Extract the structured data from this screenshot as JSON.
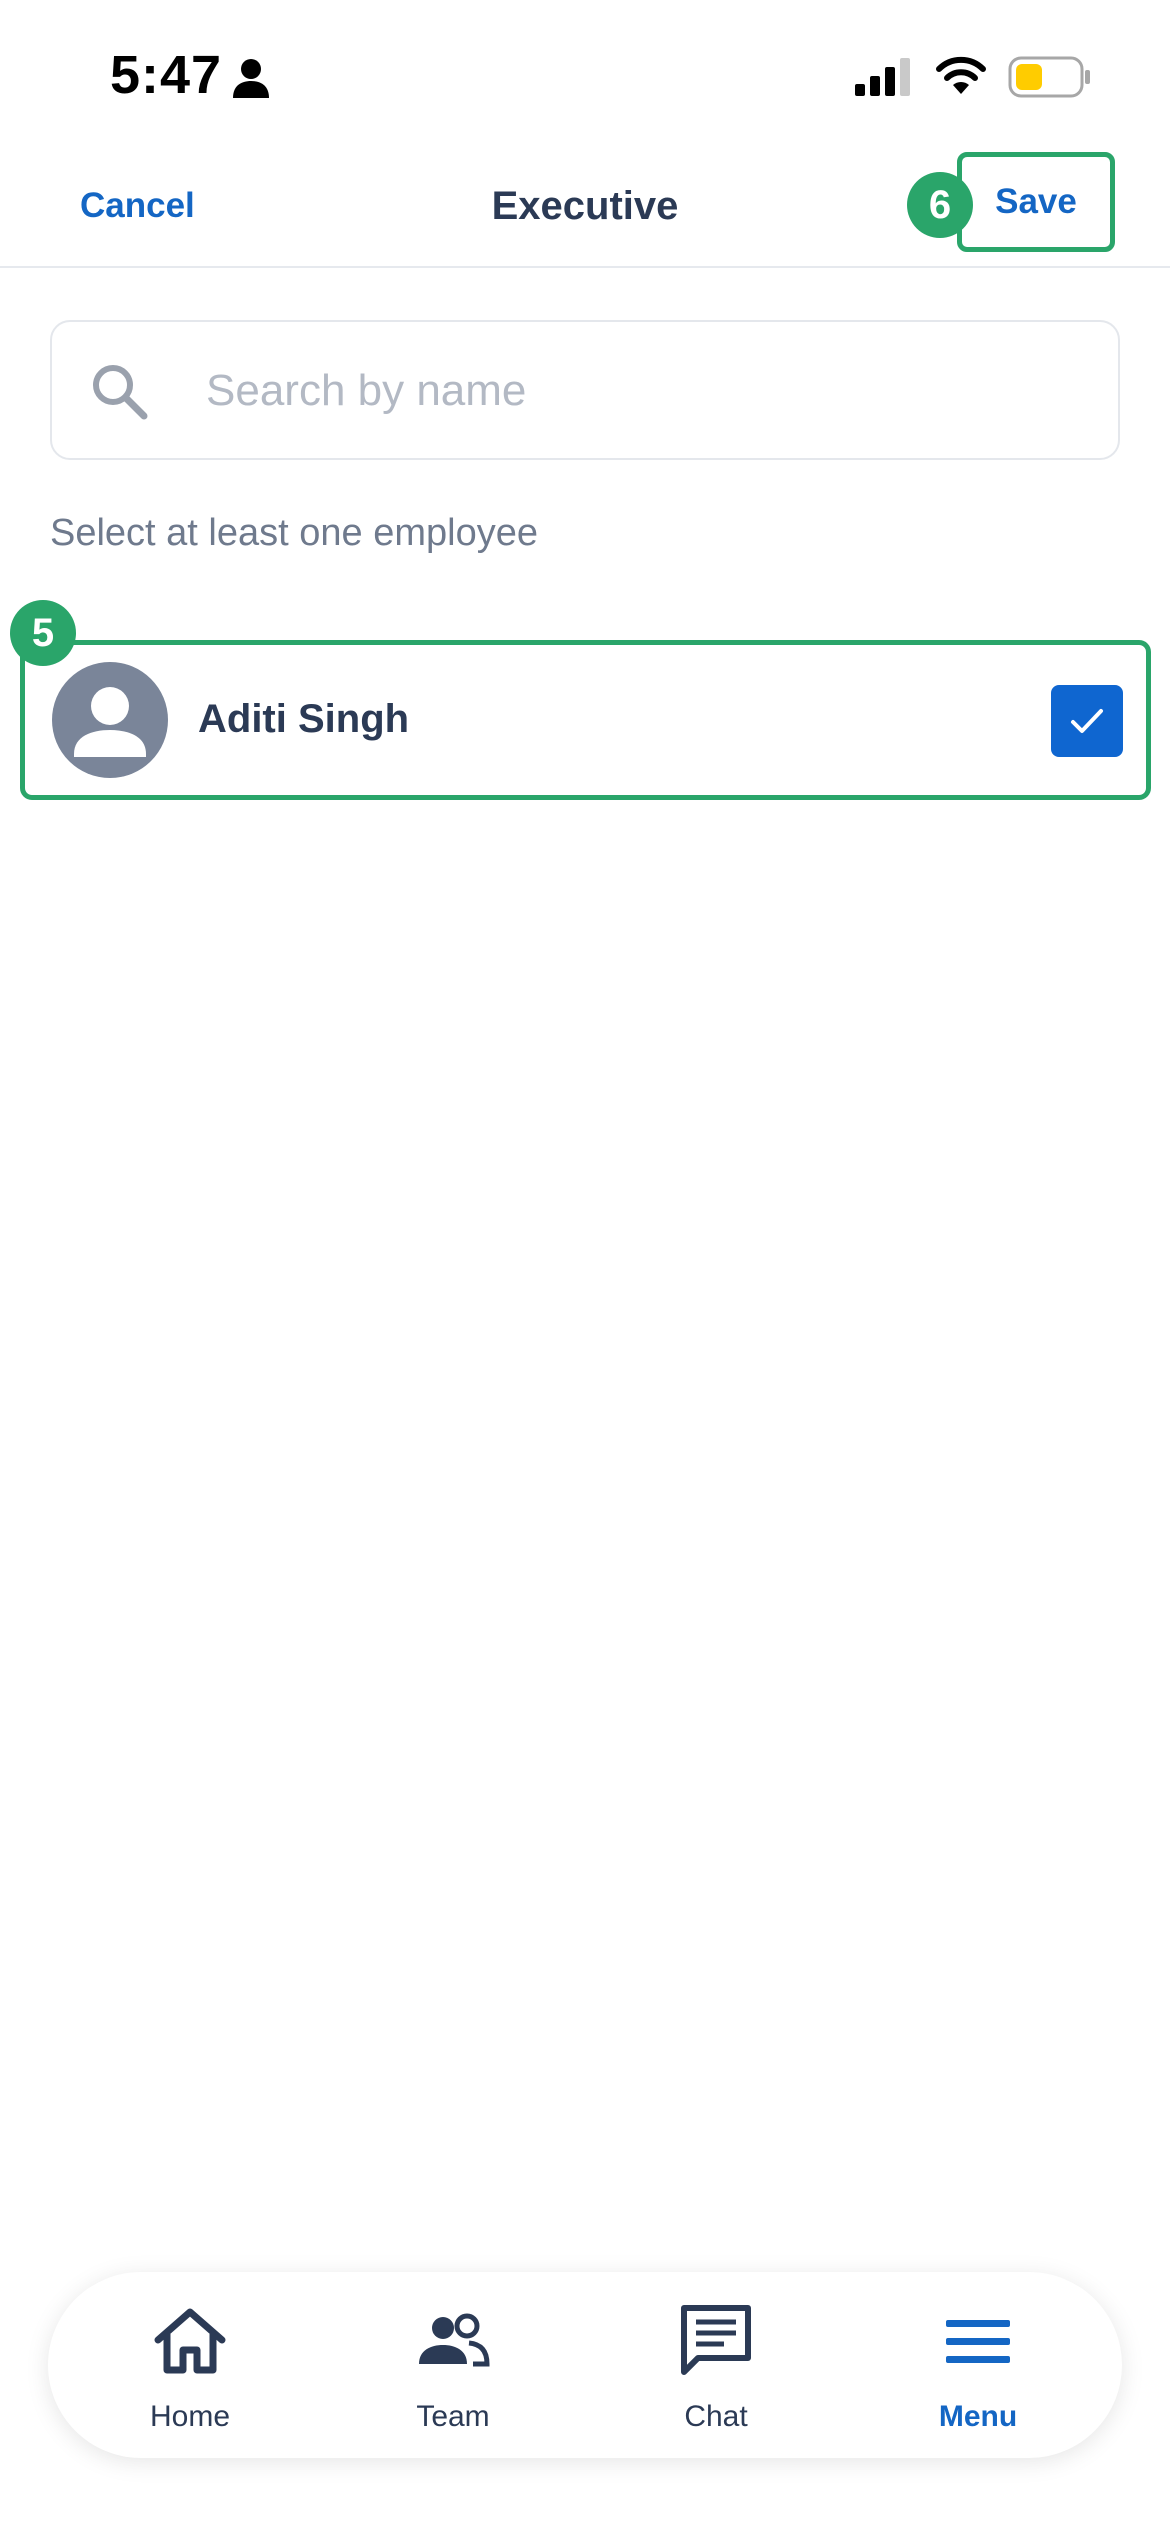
{
  "status_bar": {
    "time": "5:47",
    "icons": [
      "person-icon",
      "cellular-signal-icon",
      "wifi-icon",
      "battery-icon"
    ]
  },
  "header": {
    "cancel_label": "Cancel",
    "title": "Executive",
    "save_label": "Save"
  },
  "annotations": {
    "save_step": "6",
    "employee_step": "5"
  },
  "search": {
    "placeholder": "Search by name",
    "value": "",
    "icon": "search-icon"
  },
  "hint_text": "Select at least one employee",
  "employees": [
    {
      "name": "Aditi Singh",
      "selected": true,
      "avatar_icon": "person-avatar-icon"
    }
  ],
  "bottom_nav": {
    "items": [
      {
        "label": "Home",
        "icon": "home-icon",
        "active": false
      },
      {
        "label": "Team",
        "icon": "team-icon",
        "active": false
      },
      {
        "label": "Chat",
        "icon": "chat-icon",
        "active": false
      },
      {
        "label": "Menu",
        "icon": "menu-icon",
        "active": true
      }
    ]
  },
  "colors": {
    "accent": "#1466c4",
    "checkbox": "#0f66d0",
    "highlight": "#2aa56a",
    "text": "#2b3a55",
    "muted": "#6f7a8d",
    "avatar_bg": "#7a8599",
    "battery_fill": "#ffcc00"
  }
}
